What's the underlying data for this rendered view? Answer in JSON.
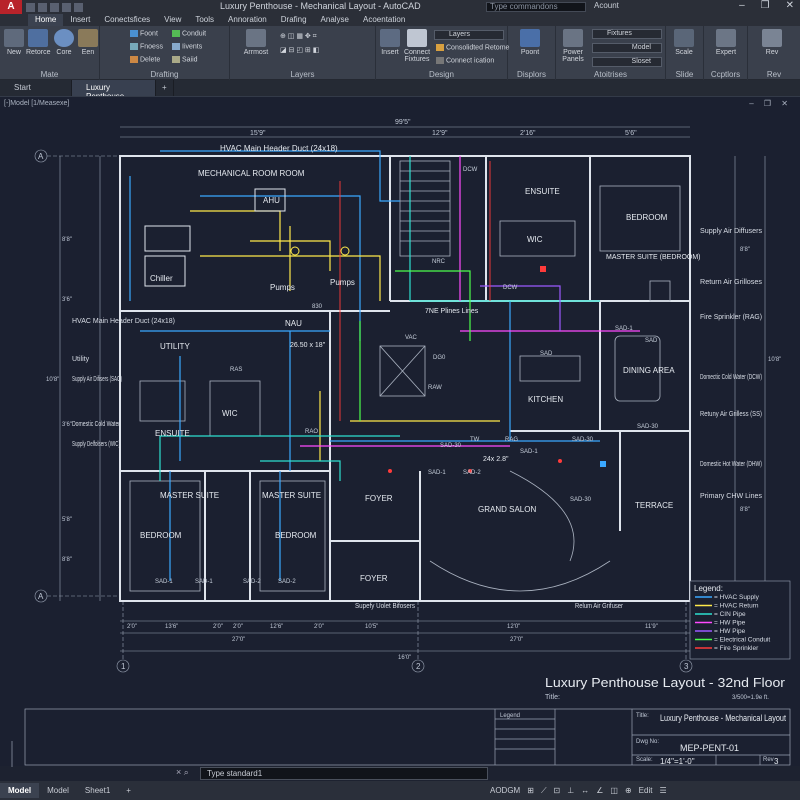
{
  "app": {
    "logo": "A",
    "title": "Luxury Penthouse - Mechanical Layout - AutoCAD",
    "search_placeholder": "Type commandons",
    "account": "Acount"
  },
  "menu": [
    "Home",
    "Insert",
    "Conectsfices",
    "View",
    "Tools",
    "Annoration",
    "Drafing",
    "Analyse",
    "Acoentation"
  ],
  "ribbon": {
    "mate": {
      "label": "Mate",
      "new": "New",
      "retorce": "Retorce",
      "core": "Core",
      "em": "Een"
    },
    "drafting": {
      "label": "Drafting",
      "items": [
        "Foont",
        "Fnoess",
        "Delete",
        "Conduit",
        "Iivents",
        "Saiid"
      ]
    },
    "layers": {
      "label": "Layers",
      "arrmost": "Arrmost"
    },
    "design": {
      "label": "Design",
      "insert": "Insert",
      "connect": "Connect Fixtures",
      "layers": "Layers",
      "consolidated": "Consolidted Retome",
      "connect_rotation": "Connect ication"
    },
    "displays": {
      "label": "Displors",
      "point": "Poont"
    },
    "attributes": {
      "label": "Atoitrises",
      "power": "Power Panels",
      "fixtures": "Fixtures",
      "model": "Model",
      "sheet": "Sloset"
    },
    "slide": {
      "label": "Slide",
      "scale": "Scale"
    },
    "captions": {
      "label": "Ccptlors",
      "expert": "Expert"
    },
    "rev": {
      "label": "Rev",
      "rev": "Rev"
    }
  },
  "tabs": [
    "Start",
    "Luxury Penthouse"
  ],
  "viewport_title": "[-]Model [1/Measexe]",
  "drawing": {
    "top_dim": "99'5\"",
    "top_dims": [
      "15'9\"",
      "12'9\"",
      "2'16\"",
      "5'6\""
    ],
    "grid_a": "A",
    "grid_cols": [
      "1",
      "2",
      "3"
    ],
    "left_dims": [
      "8'8\"",
      "3'6\"",
      "10'8\"",
      "3'6\"",
      "5'8\"",
      "8'8\""
    ],
    "right_dims": [
      "8'8\"",
      "10'8\"",
      "8'8\""
    ],
    "rooms": {
      "mech": "MECHANICAL ROOM ROOM",
      "ahu": "AHU",
      "chiller": "Chiller",
      "pumps1": "Pumps",
      "pumps2": "Pumps",
      "utility": "UTILITY",
      "nau": "NAU",
      "wic1": "WIC",
      "ensuite1": "ENSUITE",
      "master1": "MASTER SUITE",
      "bedroom1": "BEDROOM",
      "master2": "MASTER SUITE",
      "bedroom2": "BEDROOM",
      "foyer1": "FOYER",
      "foyer2": "FOYER",
      "grand": "GRAND SALON",
      "terrace": "TERRACE",
      "kitchen": "KITCHEN",
      "dining": "DINING AREA",
      "ensuite2": "ENSUITE",
      "bedroom3": "BEDROOM",
      "wic2": "WIC",
      "master3": "MASTER SUITE (BEDROOM)",
      "dcw": "DCW",
      "nrc": "NRC",
      "dcw2": "DCW",
      "vac": "VAC",
      "dg": "DG0",
      "raw": "RAW"
    },
    "tags": {
      "hvac_header": "HVAC Main Header Duct (24x18)",
      "mech_dim": "26.50 x 18\"",
      "dim_24": "24x 2.8\"",
      "sad1": "SAD-1",
      "sad2": "SAD-2",
      "sad30": "SAD-30",
      "sad": "SAD",
      "rag": "RAG",
      "tw": "TW",
      "ras": "RAS",
      "rao": "RAO",
      "b30": "830",
      "7ne": "7NE Plines Lines",
      "rag2": "RAG",
      "ra": "RA"
    },
    "left_callouts": [
      "HVAC Main Header Duct (24x18)",
      "Utility",
      "Supply Air Difisers (SAO)",
      "Domestic Cold Water",
      "Supply Delfolsers (WIC)"
    ],
    "right_callouts": [
      "Supply Air Diffusers",
      "Return Air Grilloses",
      "Fire Sprinkler (RAG)",
      "Domectic Cold Water (DCW)",
      "Retuny Air Grilless (SS)",
      "Domestic Hot Water (DHW)",
      "Primary CHW Lines"
    ],
    "bottom_callouts": [
      "Supefy Uolet Bifosers",
      "Relum Air Grifuser"
    ],
    "bottom_dims": [
      "2'0\"",
      "13'6\"",
      "2'0\"",
      "2'0\"",
      "12'6\"",
      "2'0\"",
      "10'5\"",
      "12'0\"",
      "11'9\"",
      "27'0\"",
      "27'0\"",
      "16'0\""
    ],
    "legend": {
      "title": "Legend:",
      "items": [
        {
          "label": "= HVAC Supply",
          "color": "#3aa8ff"
        },
        {
          "label": "= HVAC Return",
          "color": "#ffe94a"
        },
        {
          "label": "= CIN Pipe",
          "color": "#2de0d0"
        },
        {
          "label": "= HW Pipe",
          "color": "#ff4aff"
        },
        {
          "label": "= HW Pipe",
          "color": "#9b59ff"
        },
        {
          "label": "= Electrical Conduit",
          "color": "#4cff4c"
        },
        {
          "label": "= Fire Sprinkler",
          "color": "#ff3b3b"
        }
      ]
    },
    "big_title": "Luxury Penthouse Layout - 32nd Floor",
    "title_label": "Title:",
    "scale_note": "3/500=1.9e ft."
  },
  "titleblock": {
    "legend": "Legend",
    "title_label": "Title:",
    "title": "Luxury Penthouse - Mechanical Layout",
    "dwg_label": "Dwg No:",
    "dwg": "MEP-PENT-01",
    "scale_label": "Scale:",
    "scale": "1/4\"=1'-0\"",
    "rev_label": "Rev",
    "rev": "3"
  },
  "command": {
    "prompt": "Type standard1",
    "x": "× ⌕"
  },
  "status": {
    "tabs": [
      "Model",
      "Model",
      "Sheet1"
    ],
    "items": [
      "AODGM",
      "⊞",
      "⟋",
      "⊡",
      "⊥",
      "↔",
      "∠",
      "◫",
      "⊕",
      "Edit",
      "☰"
    ]
  }
}
